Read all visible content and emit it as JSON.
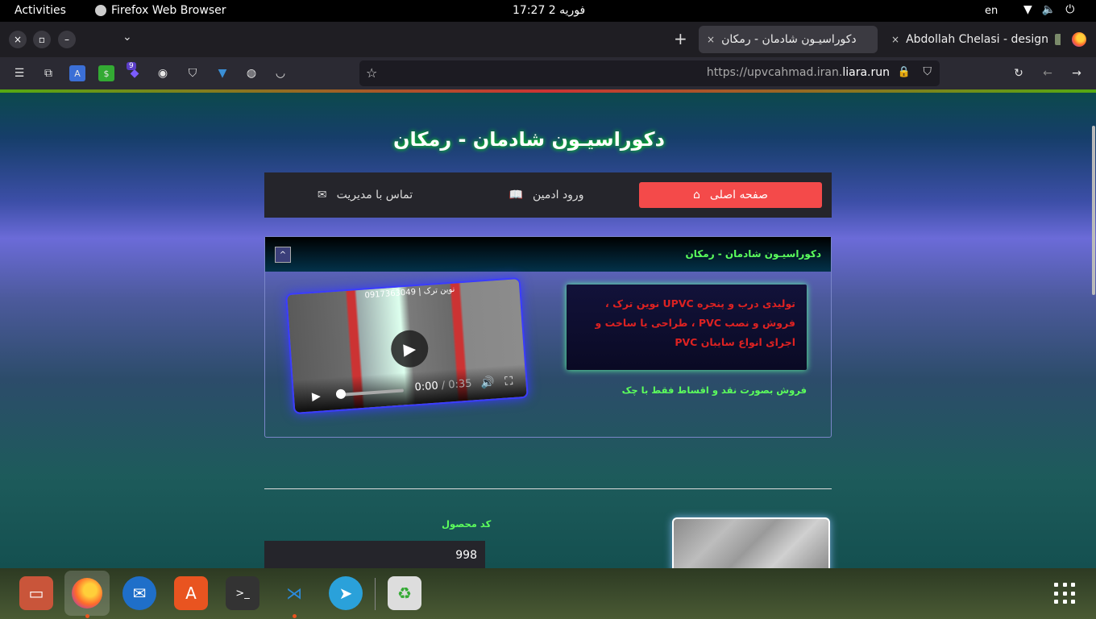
{
  "topbar": {
    "activities": "Activities",
    "app_name": "Firefox Web Browser",
    "clock": "17:27  2 فوریه",
    "lang": "en",
    "wifi_icon": "wifi-icon",
    "volume_icon": "volume-icon",
    "power_icon": "power-icon"
  },
  "tabs": {
    "active": {
      "title": "دکوراسیـون شادمان - رمکان",
      "close": "×"
    },
    "other": {
      "title": "Abdollah Chelasi - design",
      "close": "×"
    },
    "new_tab": "+"
  },
  "window_controls": {
    "close": "×",
    "restore": "▫",
    "minimize": "–",
    "list": "⌄"
  },
  "navbar": {
    "url_prefix": "https://upvcahmad.iran.",
    "url_domain": "liara.run",
    "extension_badge": "9"
  },
  "site": {
    "title": "دکوراسیـون شادمان - رمکان",
    "menu": {
      "home": "صفحه اصلی",
      "admin": "ورود ادمین",
      "contact": "تماس با مدیریت"
    },
    "panel": {
      "title": "دکوراسیـون شادمان - رمکان",
      "toggle": "^",
      "description": "تولیدی درب و پنجره UPVC نوین ترک ، فروش و نصب PVC ، طراحی یا ساخت و اجرای انواع سایبان PVC",
      "sale_note": "فروش بصورت نقد و اقساط فقط با چک",
      "video": {
        "overlay_text": "نوین ترک | 0917363049",
        "current_time": "0:00",
        "duration": "/ 0:35",
        "progress": 0
      }
    },
    "product": {
      "code_label": "کد محصول",
      "code_value": "998"
    }
  },
  "colors": {
    "accent_red": "#f44a4a",
    "green_text": "#5cff5c",
    "video_glow": "#3a3cff"
  }
}
